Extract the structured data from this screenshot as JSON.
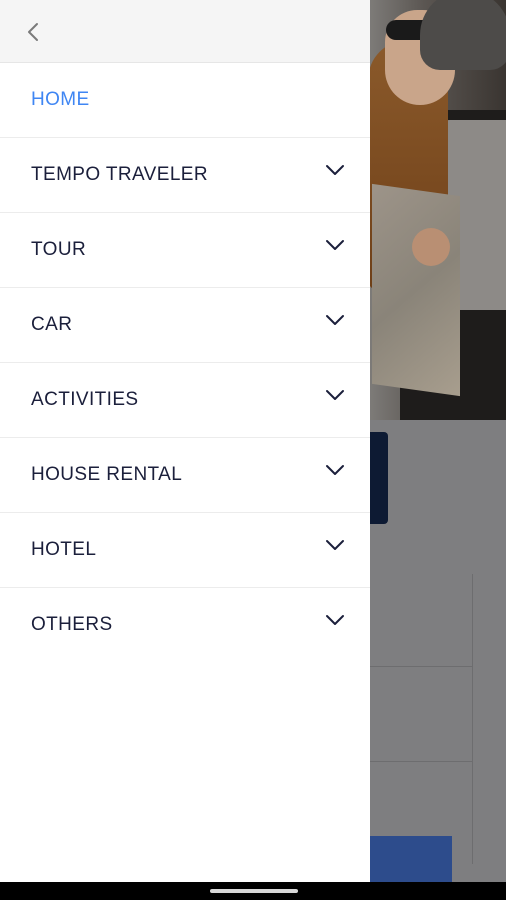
{
  "drawer": {
    "back_icon": "chevron-left-icon",
    "items": [
      {
        "label": "HOME",
        "active": true,
        "expandable": false
      },
      {
        "label": "TEMPO TRAVELER",
        "active": false,
        "expandable": true
      },
      {
        "label": "TOUR",
        "active": false,
        "expandable": true
      },
      {
        "label": "CAR",
        "active": false,
        "expandable": true
      },
      {
        "label": "ACTIVITIES",
        "active": false,
        "expandable": true
      },
      {
        "label": "HOUSE RENTAL",
        "active": false,
        "expandable": true
      },
      {
        "label": "HOTEL",
        "active": false,
        "expandable": true
      },
      {
        "label": "OTHERS",
        "active": false,
        "expandable": true
      }
    ],
    "expand_icon": "chevron-down-icon"
  },
  "colors": {
    "active": "#3f86f3",
    "text": "#1b1f3b",
    "header_bg": "#f5f5f5",
    "overlay": "#7e7e80",
    "brand_blue": "#2d4c8c",
    "brand_dark": "#0d1a33"
  }
}
